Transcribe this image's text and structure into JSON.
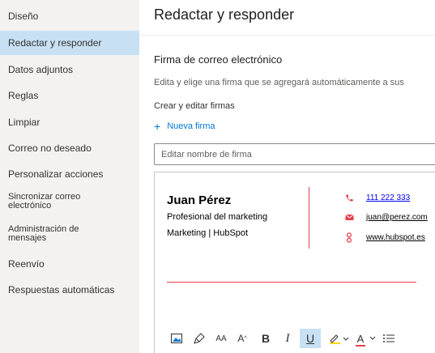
{
  "sidebar": {
    "items": [
      {
        "label": "Diseño"
      },
      {
        "label": "Redactar y responder",
        "selected": true
      },
      {
        "label": "Datos adjuntos"
      },
      {
        "label": "Reglas"
      },
      {
        "label": "Limpiar"
      },
      {
        "label": "Correo no deseado"
      },
      {
        "label": "Personalizar acciones"
      },
      {
        "label": "Sincronizar correo electrónico"
      },
      {
        "label": "Administración de mensajes"
      },
      {
        "label": "Reenvío"
      },
      {
        "label": "Respuestas automáticas"
      }
    ]
  },
  "main": {
    "title": "Redactar y responder",
    "section_title": "Firma de correo electrónico",
    "section_desc": "Edita y elige una firma que se agregará automáticamente a sus",
    "sub_title": "Crear y editar firmas",
    "new_signature_label": "Nueva firma",
    "name_input_placeholder": "Editar nombre de firma",
    "name_input_value": ""
  },
  "signature": {
    "name": "Juan Pérez",
    "role": "Profesional del marketing",
    "company": "Marketing | HubSpot",
    "phone": "111 222 333",
    "email": "juan@perez.com",
    "website": "www.hubspot.es"
  },
  "colors": {
    "accent": "#0078d4",
    "selected_bg": "#c7e0f4",
    "signature_accent": "#e5404e"
  },
  "toolbar": {
    "icons": [
      "insert-image-icon",
      "format-painter-icon",
      "font-size-icon",
      "font-size-increase-icon",
      "bold-icon",
      "italic-icon",
      "underline-icon",
      "highlight-icon",
      "font-color-icon",
      "bullets-icon"
    ],
    "bold_label": "B",
    "italic_label": "I",
    "underline_label": "U",
    "font_size_label": "AA",
    "font_grow_label": "A",
    "font_color_label": "A"
  }
}
